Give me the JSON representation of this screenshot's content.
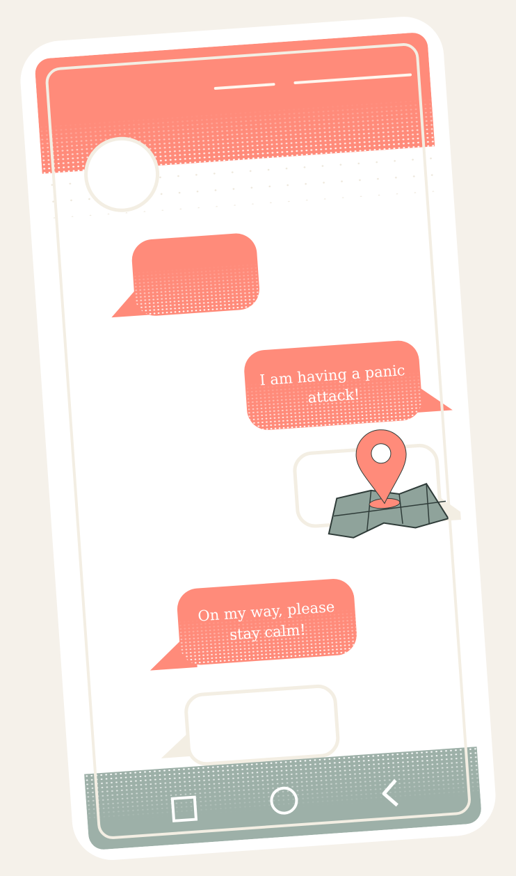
{
  "messages": {
    "sent_1": "I am having a panic attack!",
    "received_1": "On my way, please stay calm!"
  },
  "icons": {
    "location": "map-pin-icon",
    "nav_recent": "square-icon",
    "nav_home": "circle-icon",
    "nav_back": "chevron-left-icon"
  },
  "colors": {
    "background": "#F5F1EA",
    "accent": "#FF8B7A",
    "nav": "#9DB0A8",
    "map": "#8FA39B"
  }
}
